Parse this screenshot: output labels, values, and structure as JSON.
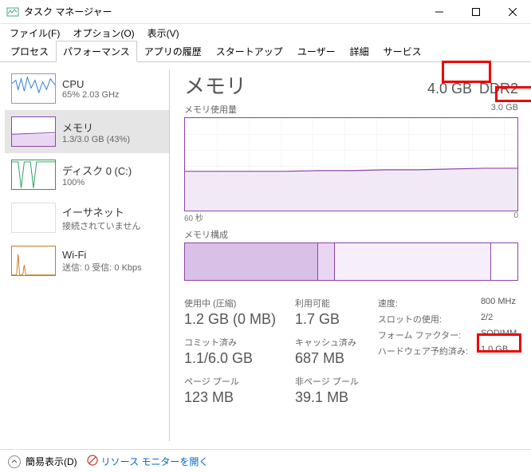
{
  "window": {
    "title": "タスク マネージャー"
  },
  "menu": {
    "file": "ファイル(F)",
    "options": "オプション(O)",
    "view": "表示(V)"
  },
  "tabs": {
    "processes": "プロセス",
    "performance": "パフォーマンス",
    "app_history": "アプリの履歴",
    "startup": "スタートアップ",
    "users": "ユーザー",
    "details": "詳細",
    "services": "サービス"
  },
  "sidebar": {
    "cpu": {
      "title": "CPU",
      "sub": "65%  2.03 GHz"
    },
    "memory": {
      "title": "メモリ",
      "sub": "1.3/3.0 GB (43%)"
    },
    "disk": {
      "title": "ディスク 0 (C:)",
      "sub": "100%"
    },
    "ethernet": {
      "title": "イーサネット",
      "sub": "接続されていません"
    },
    "wifi": {
      "title": "Wi-Fi",
      "sub": "送信: 0 受信: 0 Kbps"
    }
  },
  "main": {
    "title": "メモリ",
    "total": "4.0 GB",
    "type": "DDR2",
    "usage_label": "メモリ使用量",
    "usage_max": "3.0 GB",
    "axis_left": "60 秒",
    "axis_right": "0",
    "comp_label": "メモリ構成",
    "stats": {
      "in_use_label": "使用中 (圧縮)",
      "in_use": "1.2 GB (0 MB)",
      "available_label": "利用可能",
      "available": "1.7 GB",
      "committed_label": "コミット済み",
      "committed": "1.1/6.0 GB",
      "cached_label": "キャッシュ済み",
      "cached": "687 MB",
      "paged_label": "ページ プール",
      "paged": "123 MB",
      "nonpaged_label": "非ページ プール",
      "nonpaged": "39.1 MB"
    },
    "right": {
      "speed_k": "速度:",
      "speed_v": "800 MHz",
      "slots_k": "スロットの使用:",
      "slots_v": "2/2",
      "ff_k": "フォーム ファクター:",
      "ff_v": "SODIMM",
      "hwres_k": "ハードウェア予約済み:",
      "hwres_v": "1.0 GB"
    }
  },
  "footer": {
    "fewer": "簡易表示(D)",
    "resmon": "リソース モニターを開く"
  },
  "chart_data": {
    "type": "line",
    "title": "メモリ使用量",
    "xlabel": "60 秒",
    "ylabel": "",
    "ylim": [
      0,
      3.0
    ],
    "x": [
      0,
      5,
      10,
      15,
      20,
      25,
      30,
      35,
      40,
      45,
      50,
      55,
      60
    ],
    "series": [
      {
        "name": "使用中",
        "values": [
          1.3,
          1.3,
          1.3,
          1.3,
          1.29,
          1.29,
          1.28,
          1.28,
          1.27,
          1.27,
          1.26,
          1.25,
          1.25
        ]
      }
    ]
  }
}
